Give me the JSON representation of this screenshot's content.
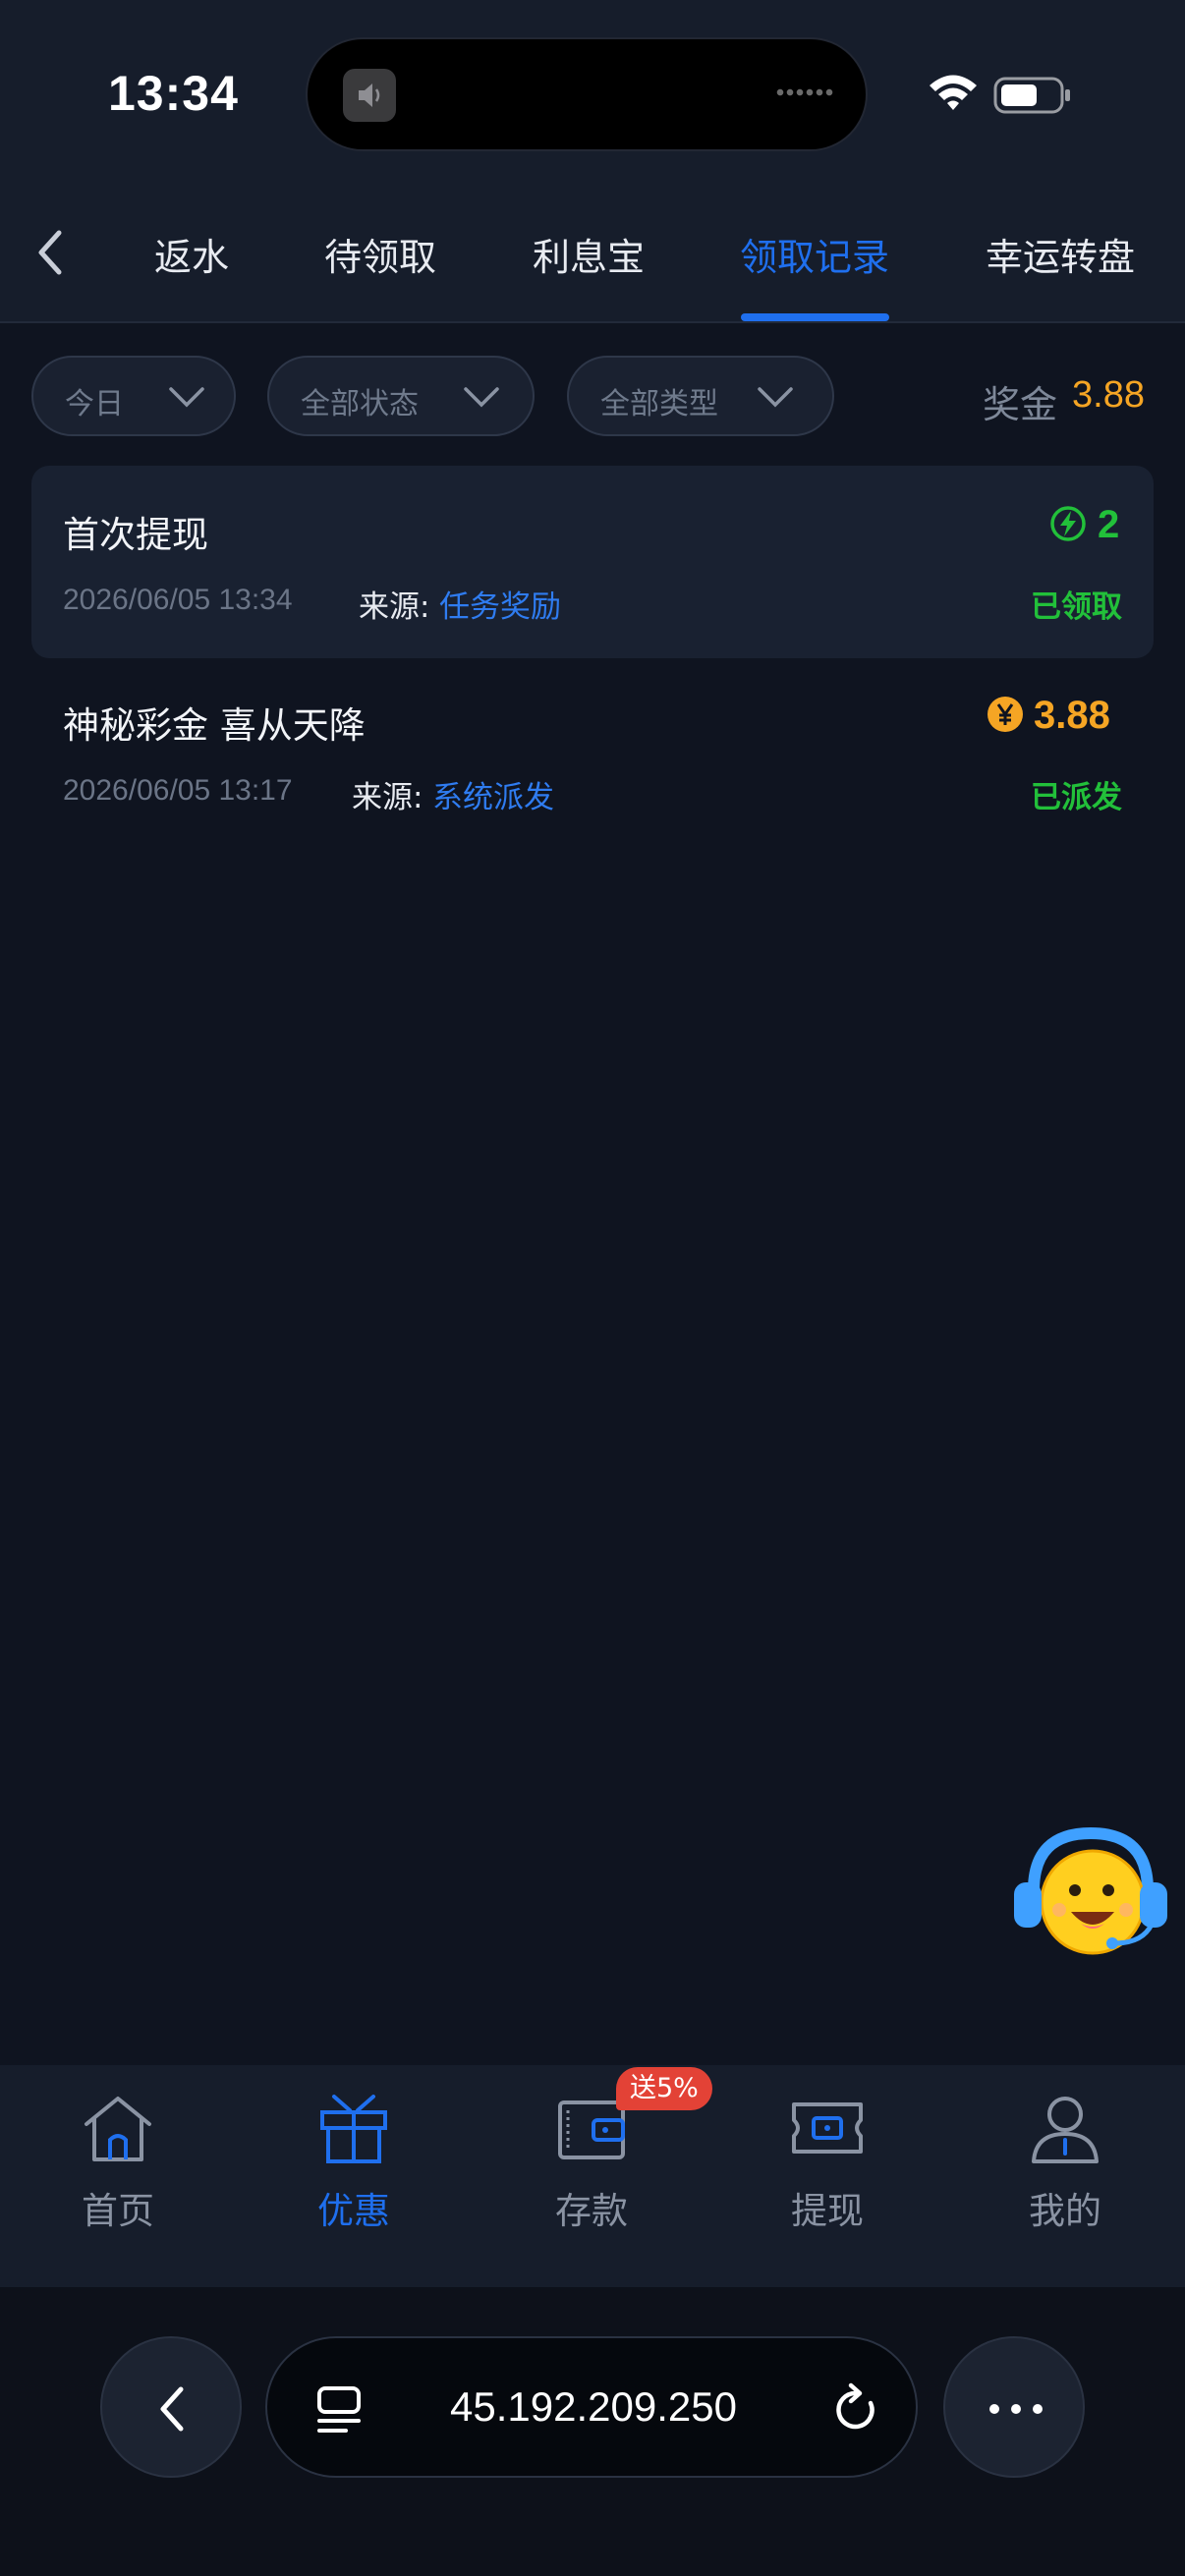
{
  "status_bar": {
    "time": "13:34"
  },
  "tabs": [
    {
      "label": "返水"
    },
    {
      "label": "待领取"
    },
    {
      "label": "利息宝"
    },
    {
      "label": "领取记录",
      "active": true
    },
    {
      "label": "幸运转盘"
    }
  ],
  "filters": {
    "date": "今日",
    "status": "全部状态",
    "type": "全部类型"
  },
  "bonus": {
    "label": "奖金",
    "value": "3.88"
  },
  "records": [
    {
      "title": "首次提现",
      "date": "2026/06/05 13:34",
      "source_label": "来源:",
      "source": "任务奖励",
      "amount": "2",
      "amount_icon": "lightning-coin-icon",
      "amount_color": "#22c03a",
      "status": "已领取"
    },
    {
      "title": "神秘彩金 喜从天降",
      "date": "2026/06/05 13:17",
      "source_label": "来源:",
      "source": "系统派发",
      "amount": "3.88",
      "amount_icon": "yen-coin-icon",
      "amount_color": "#f5a524",
      "status": "已派发"
    }
  ],
  "bottom_nav": [
    {
      "label": "首页",
      "icon": "home-icon"
    },
    {
      "label": "优惠",
      "icon": "gift-icon",
      "active": true
    },
    {
      "label": "存款",
      "icon": "wallet-icon"
    },
    {
      "label": "提现",
      "icon": "ticket-icon"
    },
    {
      "label": "我的",
      "icon": "user-icon"
    }
  ],
  "promo_badge": "送5%",
  "browser": {
    "url": "45.192.209.250"
  },
  "colors": {
    "accent": "#1f6fee",
    "success": "#22c03a",
    "gold": "#f5a524",
    "background": "#0f1420"
  }
}
